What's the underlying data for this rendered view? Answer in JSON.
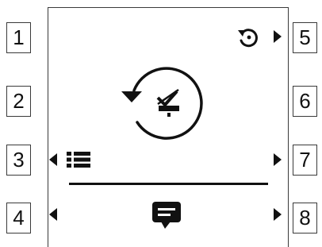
{
  "softkeys_left": [
    "1",
    "2",
    "3",
    "4"
  ],
  "softkeys_right": [
    "5",
    "6",
    "7",
    "8"
  ],
  "screen": {
    "top_right": {
      "icon": "rotate-back-icon",
      "arrow": "arrow-right"
    },
    "center": {
      "icon": "rotate-ccw-circle-icon",
      "inner_icon": "check-mark-no-icon",
      "arrow": "arrow-down"
    },
    "menu_row": {
      "left_arrow": "arrow-left",
      "icon": "list-icon",
      "right_arrow": "arrow-right"
    },
    "message_row": {
      "left_arrow": "arrow-left",
      "icon": "message-icon",
      "right_arrow": "arrow-right"
    }
  },
  "colors": {
    "ink": "#111111",
    "border": "#3a3a3a",
    "background": "#ffffff"
  }
}
